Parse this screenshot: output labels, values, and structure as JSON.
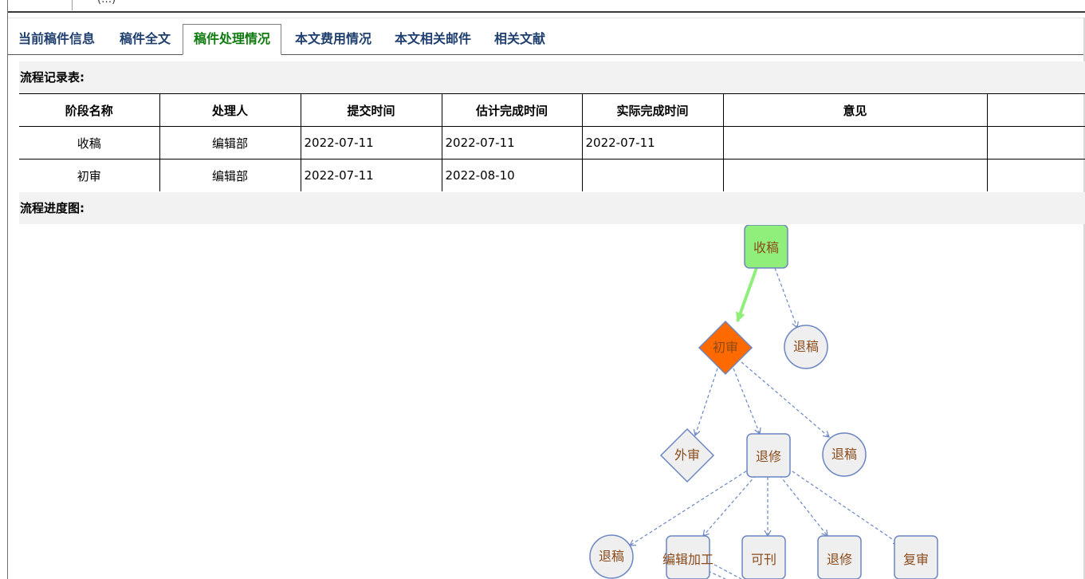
{
  "top_fragment": "(…)",
  "tabs": [
    {
      "label": "当前稿件信息"
    },
    {
      "label": "稿件全文"
    },
    {
      "label": "稿件处理情况",
      "active": true
    },
    {
      "label": "本文费用情况"
    },
    {
      "label": "本文相关邮件"
    },
    {
      "label": "相关文献"
    }
  ],
  "records": {
    "title": "流程记录表:",
    "headers": [
      "阶段名称",
      "处理人",
      "提交时间",
      "估计完成时间",
      "实际完成时间",
      "意见",
      ""
    ],
    "rows": [
      [
        "收稿",
        "编辑部",
        "2022-07-11",
        "2022-07-11",
        "2022-07-11",
        "",
        ""
      ],
      [
        "初审",
        "编辑部",
        "2022-07-11",
        "2022-08-10",
        "",
        "",
        ""
      ]
    ]
  },
  "flow": {
    "title": "流程进度图:",
    "nodes": {
      "shougao": "收稿",
      "tuigao1": "退稿",
      "chushen": "初审",
      "waishen": "外审",
      "tuixiu1": "退修",
      "tuigao2": "退稿",
      "tuigao3": "退稿",
      "bianji": "编辑加工",
      "kekan": "可刊",
      "tuixiu2": "退修",
      "fushen": "复审"
    },
    "colors": {
      "done": "#90ee7a",
      "current": "#ff6a00",
      "pending_fill": "#efefef",
      "stroke": "#6b86c2",
      "label": "#8b4a1a",
      "done_edge": "#90ee7a"
    }
  }
}
